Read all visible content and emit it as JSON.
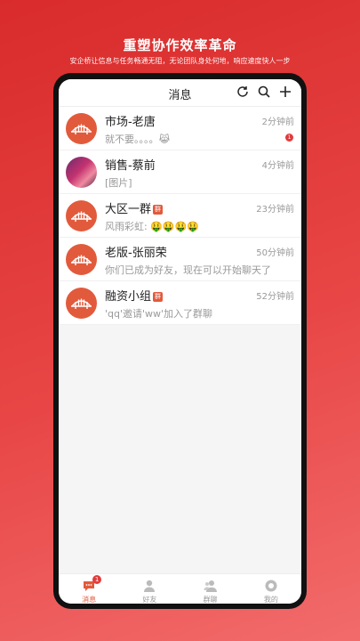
{
  "promo": {
    "title": "重塑协作效率革命",
    "subtitle": "安企桥让信息与任务畅通无阻，无论团队身处何地，响应速度快人一步"
  },
  "header": {
    "title": "消息"
  },
  "conversations": [
    {
      "name": "市场-老唐",
      "is_group": false,
      "time": "2分钟前",
      "preview": "就不要。。。。😹",
      "unread": "1",
      "avatar": "bridge-logo"
    },
    {
      "name": "销售-蔡前",
      "is_group": false,
      "time": "4分钟前",
      "preview": "[图片]",
      "unread": "",
      "avatar": "photo"
    },
    {
      "name": "大区一群",
      "is_group": true,
      "group_tag": "群",
      "time": "23分钟前",
      "preview": "风雨彩虹: 🤑🤑🤑🤑",
      "unread": "",
      "avatar": "bridge-logo"
    },
    {
      "name": "老版-张丽荣",
      "is_group": false,
      "time": "50分钟前",
      "preview": "你们已成为好友，现在可以开始聊天了",
      "unread": "",
      "avatar": "bridge-logo"
    },
    {
      "name": "融资小组",
      "is_group": true,
      "group_tag": "群",
      "time": "52分钟前",
      "preview": "'qq'邀请'ww'加入了群聊",
      "unread": "",
      "avatar": "bridge-logo"
    }
  ],
  "tabs": [
    {
      "label": "消息",
      "icon": "chat-icon",
      "active": true,
      "badge": "1"
    },
    {
      "label": "好友",
      "icon": "person-icon",
      "active": false,
      "badge": ""
    },
    {
      "label": "群聊",
      "icon": "group-icon",
      "active": false,
      "badge": ""
    },
    {
      "label": "我的",
      "icon": "profile-icon",
      "active": false,
      "badge": ""
    }
  ],
  "colors": {
    "accent": "#e25a3c",
    "badge": "#e23b3b"
  }
}
